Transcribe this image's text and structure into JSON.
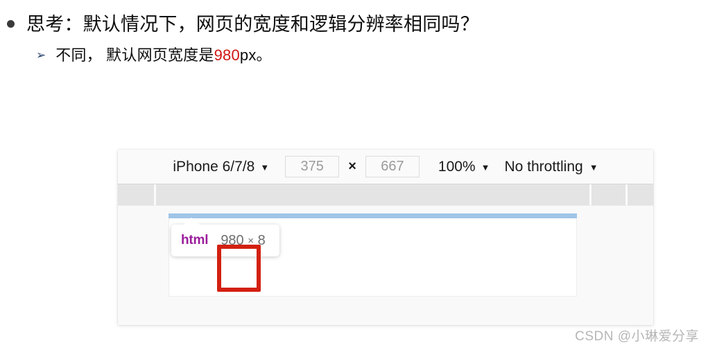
{
  "slide": {
    "bullet_level1": {
      "marker": "●",
      "text": "思考：默认情况下，网页的宽度和逻辑分辨率相同吗？"
    },
    "bullet_level2": {
      "marker": "➢",
      "text_before": "不同， 默认网页宽度是",
      "highlight": "980",
      "text_after": "px。",
      "highlight_color": "#d01616"
    }
  },
  "devtools": {
    "device_toolbar": {
      "device_label": "iPhone 6/7/8",
      "device_caret": "▼",
      "width_value": "375",
      "dimension_separator": "×",
      "height_value": "667",
      "zoom_label": "100%",
      "zoom_caret": "▼",
      "throttle_label": "No throttling",
      "throttle_caret": "▼"
    },
    "secondary_strip": {
      "separator_offsets": [
        52,
        680,
        732
      ]
    },
    "element_tooltip": {
      "tag_name": "html",
      "width": "980",
      "times": "×",
      "height": "8"
    },
    "highlight_bar_color": "#a0c5e8",
    "annotation_box_color": "#d32010"
  },
  "watermark": {
    "text": "CSDN @小琳爱分享"
  }
}
